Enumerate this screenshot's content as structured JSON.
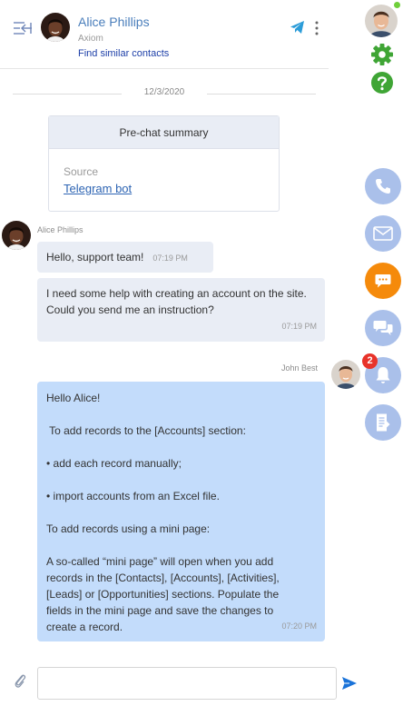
{
  "header": {
    "contact_name": "Alice Phillips",
    "contact_company": "Axiom",
    "similar_link": "Find similar contacts"
  },
  "date_divider": "12/3/2020",
  "prechat": {
    "title": "Pre-chat summary",
    "source_label": "Source",
    "source_value": "Telegram bot"
  },
  "messages": [
    {
      "sender": "Alice Phillips",
      "direction": "incoming",
      "lines": [
        "Hello, support team!"
      ],
      "time": "07:19 PM"
    },
    {
      "sender": "",
      "direction": "incoming",
      "lines": [
        "I need some help with creating an account on the site.",
        "Could you send me an instruction?"
      ],
      "time": "07:19 PM"
    },
    {
      "sender": "John Best",
      "direction": "outgoing",
      "lines": [
        "Hello Alice!",
        "",
        " To add records to the [Accounts] section:",
        "",
        "• add each record manually;",
        "",
        "• import accounts from an Excel file.",
        "",
        "To add records using a mini page:",
        "",
        "A so-called “mini page” will open when you add records in the [Contacts], [Accounts], [Activities], [Leads] or [Opportunities] sections. Populate the fields in the mini page and save the changes to create a record."
      ],
      "time": "07:20 PM"
    }
  ],
  "composer": {
    "value": "",
    "placeholder": ""
  },
  "sidebar": {
    "notification_count": "2",
    "buttons": [
      "phone-icon",
      "email-icon",
      "chat-icon",
      "conversations-icon",
      "bell-icon",
      "feed-icon"
    ]
  },
  "colors": {
    "accent_blue": "#aac0ea",
    "active_orange": "#f58a0b",
    "badge_red": "#e8332a",
    "outgoing_bubble": "#c3dcfb",
    "incoming_bubble": "#e9edf5",
    "green_icons": "#3fa535"
  }
}
